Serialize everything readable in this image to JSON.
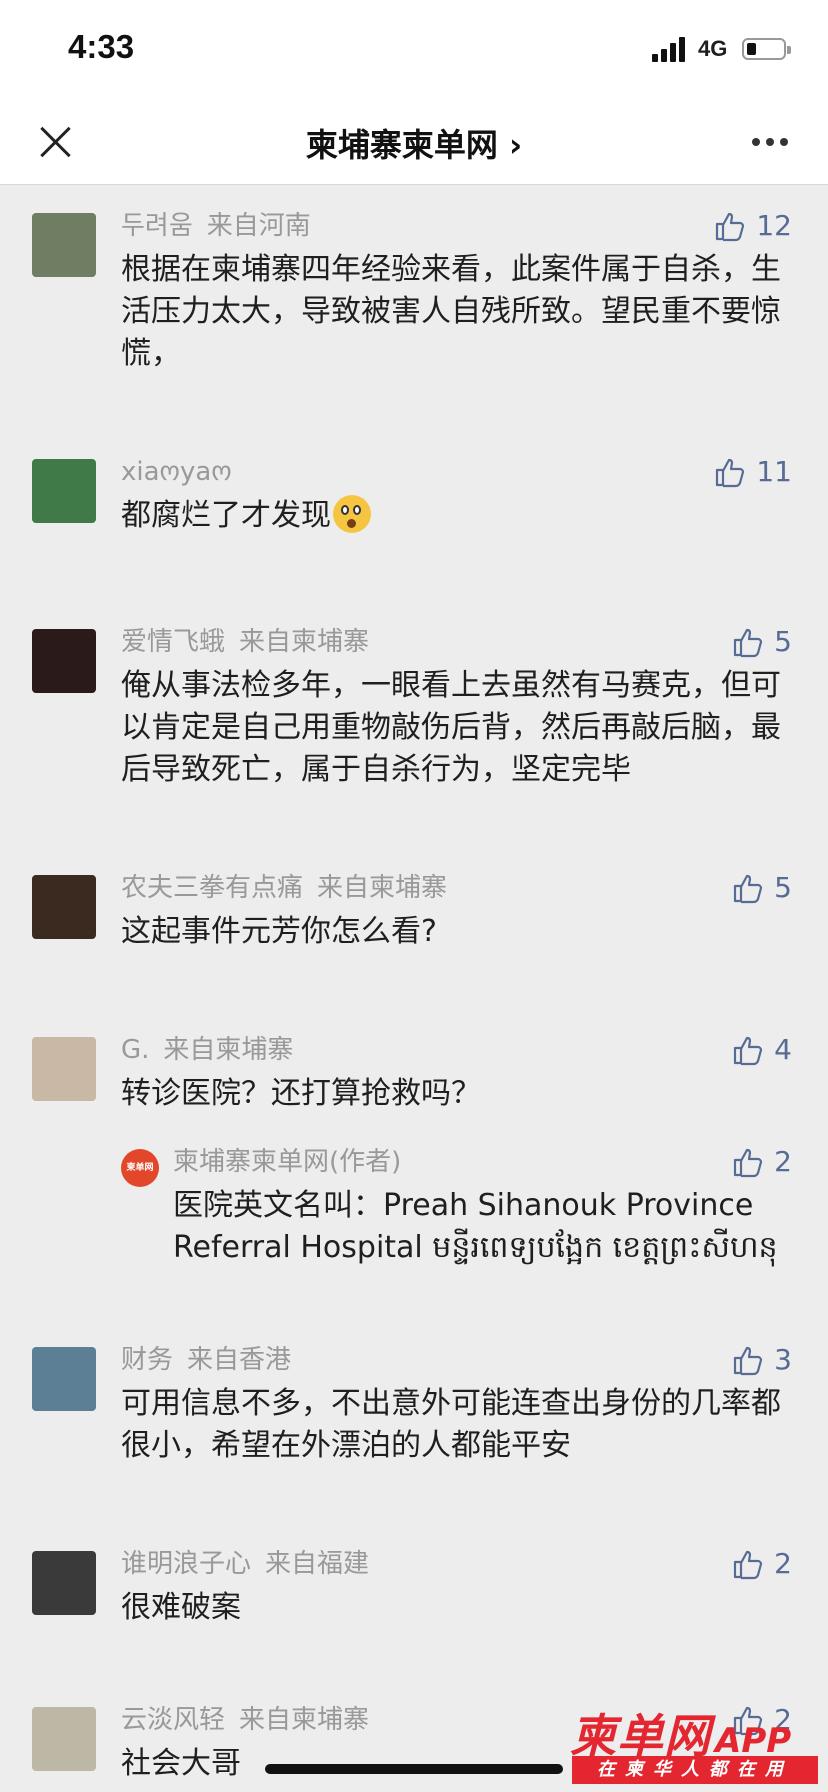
{
  "status": {
    "time": "4:33",
    "network": "4G"
  },
  "nav": {
    "title": "柬埔寨柬单网 ›"
  },
  "comments": [
    {
      "user": "두려움",
      "region": "来自河南",
      "likes": "12",
      "text": "根据在柬埔寨四年经验来看，此案件属于自杀，生活压力太大，导致被害人自残所致。望民重不要惊慌，",
      "avatar_color": "#6f7d63"
    },
    {
      "user": "xiaოyaო",
      "region": "",
      "likes": "11",
      "text": "都腐烂了才发现",
      "avatar_color": "#3f7a48"
    },
    {
      "user": "爱情飞蛾",
      "region": "来自柬埔寨",
      "likes": "5",
      "text": "俺从事法检多年，一眼看上去虽然有马赛克，但可以肯定是自己用重物敲伤后背，然后再敲后脑，最后导致死亡，属于自杀行为，坚定完毕",
      "avatar_color": "#2a1a1a"
    },
    {
      "user": "农夫三拳有点痛",
      "region": "来自柬埔寨",
      "likes": "5",
      "text": "这起事件元芳你怎么看?",
      "avatar_color": "#3a2a20"
    },
    {
      "user": "G.",
      "region": "来自柬埔寨",
      "likes": "4",
      "text": "转诊医院？还打算抢救吗？",
      "avatar_color": "#c9b8a6",
      "reply": {
        "user": "柬埔寨柬单网(作者)",
        "likes": "2",
        "text": "医院英文名叫：Preah Sihanouk Province Referral Hospital មន្ទីរពេទ្យបង្អែក ខេត្តព្រះសីហនុ",
        "avatar_text": "柬单网"
      }
    },
    {
      "user": "财务",
      "region": "来自香港",
      "likes": "3",
      "text": "可用信息不多，不出意外可能连查出身份的几率都很小，希望在外漂泊的人都能平安",
      "avatar_color": "#5d7f95"
    },
    {
      "user": "谁明浪子心",
      "region": "来自福建",
      "likes": "2",
      "text": "很难破案",
      "avatar_color": "#3a3a3a"
    },
    {
      "user": "云淡风轻",
      "region": "来自柬埔寨",
      "likes": "2",
      "text": "社会大哥",
      "avatar_color": "#bdb8a6"
    }
  ],
  "watermark": {
    "main": "柬单网",
    "app": "APP",
    "sub": "在柬华人都在用"
  }
}
